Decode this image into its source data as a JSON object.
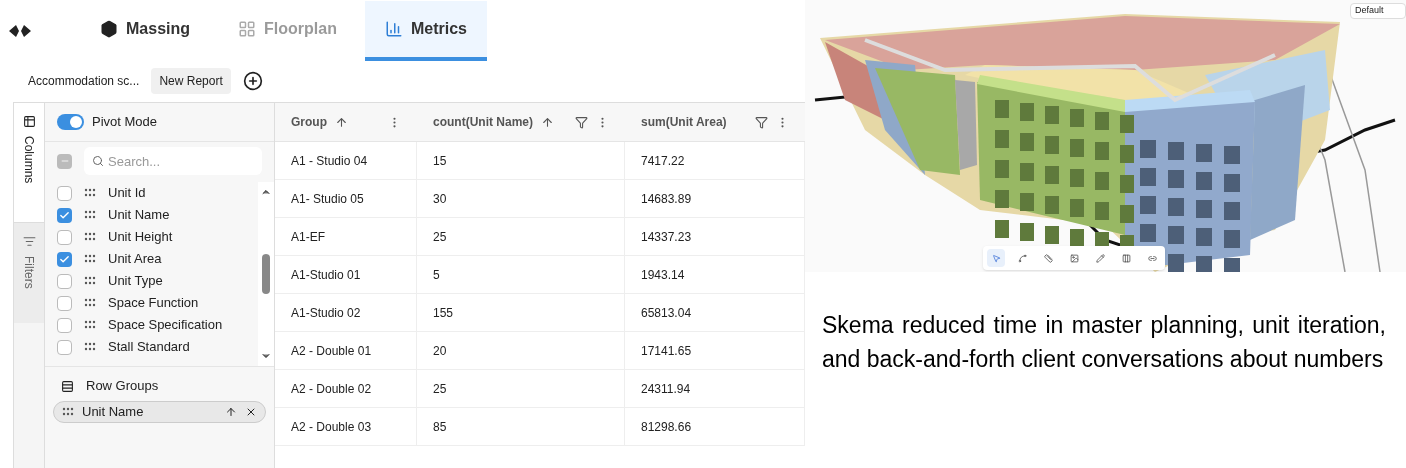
{
  "tabs": [
    {
      "label": "Massing",
      "selected": false,
      "disabled": false
    },
    {
      "label": "Floorplan",
      "selected": false,
      "disabled": true
    },
    {
      "label": "Metrics",
      "selected": true,
      "disabled": false
    }
  ],
  "reports": [
    {
      "label": "Accommodation sc...",
      "selected": false
    },
    {
      "label": "New Report",
      "selected": true
    }
  ],
  "side_tabs": [
    {
      "label": "Columns",
      "selected": true
    },
    {
      "label": "Filters",
      "selected": false
    }
  ],
  "pivot_mode": {
    "label": "Pivot Mode",
    "on": true
  },
  "select_all": {
    "indeterminate": true
  },
  "search": {
    "placeholder": "Search..."
  },
  "columns": [
    {
      "label": "Unit Id",
      "checked": false
    },
    {
      "label": "Unit Name",
      "checked": true
    },
    {
      "label": "Unit Height",
      "checked": false
    },
    {
      "label": "Unit Area",
      "checked": true
    },
    {
      "label": "Unit Type",
      "checked": false
    },
    {
      "label": "Space Function",
      "checked": false
    },
    {
      "label": "Space Specification",
      "checked": false
    },
    {
      "label": "Stall Standard",
      "checked": false
    }
  ],
  "row_groups": {
    "title": "Row Groups",
    "chips": [
      {
        "label": "Unit Name"
      }
    ]
  },
  "table": {
    "columns": [
      {
        "label": "Group",
        "sorted": true,
        "filter": false
      },
      {
        "label": "count(Unit Name)",
        "sorted": true,
        "filter": true
      },
      {
        "label": "sum(Unit Area)",
        "sorted": false,
        "filter": true
      }
    ],
    "rows": [
      [
        "A1 - Studio 04",
        "15",
        "7417.22"
      ],
      [
        "A1- Studio 05",
        "30",
        "14683.89"
      ],
      [
        "A1-EF",
        "25",
        "14337.23"
      ],
      [
        "A1-Studio 01",
        "5",
        "1943.14"
      ],
      [
        "A1-Studio 02",
        "155",
        "65813.04"
      ],
      [
        "A2 - Double 01",
        "20",
        "17141.65"
      ],
      [
        "A2 - Double 02",
        "25",
        "24311.94"
      ],
      [
        "A2 - Double 03",
        "85",
        "81298.66"
      ]
    ]
  },
  "viewer": {
    "dropdown": "Default",
    "tools": [
      {
        "selected": true
      },
      {
        "selected": false
      },
      {
        "selected": false
      },
      {
        "selected": false
      },
      {
        "selected": false
      },
      {
        "selected": false
      },
      {
        "selected": false
      }
    ]
  },
  "caption": "Skema reduced time in master planning, unit iteration, and back-and-forth client conversations about numbers"
}
